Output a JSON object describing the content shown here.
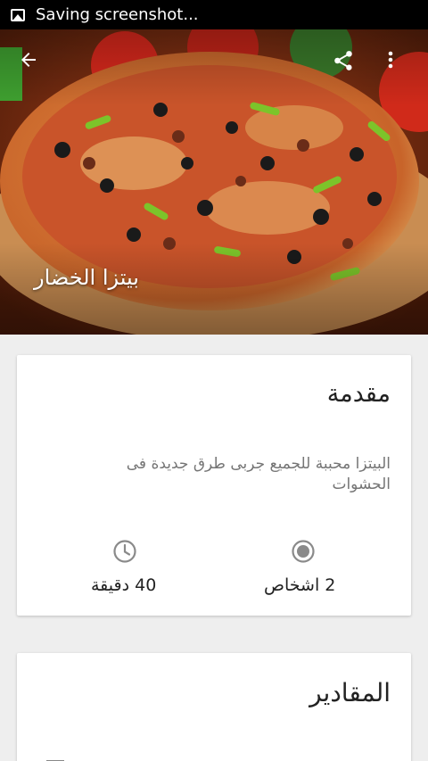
{
  "status_bar": {
    "text": "Saving screenshot..."
  },
  "header": {
    "title": "بيتزا الخضار",
    "back_icon": "arrow-back-icon",
    "share_icon": "share-icon",
    "more_icon": "more-vert-icon"
  },
  "intro": {
    "heading": "مقدمة",
    "description": "البيتزا محببة للجميع جربى طرق جديدة فى الحشوات",
    "time": "40 دقيقة",
    "servings": "2 اشخاص",
    "time_icon": "clock-icon",
    "servings_icon": "radio-icon"
  },
  "ingredients": {
    "heading": "المقادير"
  }
}
